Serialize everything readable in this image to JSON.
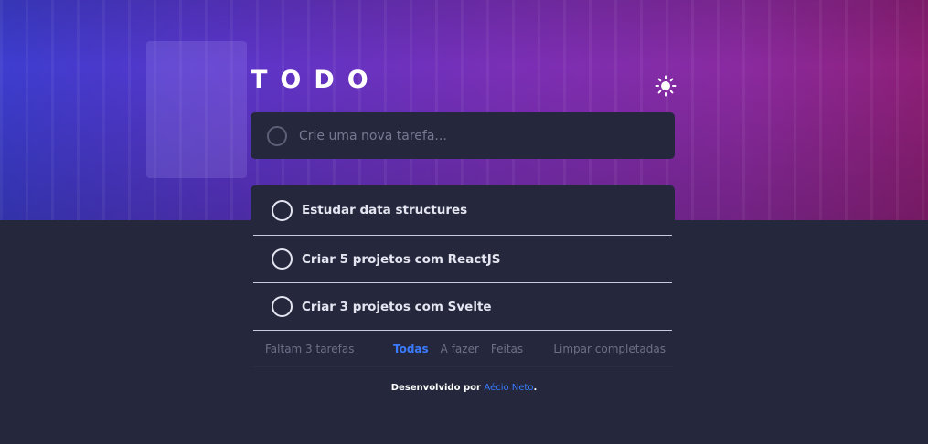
{
  "header": {
    "title": "TODO",
    "theme_icon": "sun-icon"
  },
  "new_todo": {
    "placeholder": "Crie uma nova tarefa..."
  },
  "todos": [
    {
      "text": "Estudar data structures",
      "completed": false
    },
    {
      "text": "Criar 5 projetos com ReactJS",
      "completed": false
    },
    {
      "text": "Criar 3 projetos com Svelte",
      "completed": false
    }
  ],
  "footer": {
    "remaining": "Faltam 3 tarefas",
    "filters": {
      "all": "Todas",
      "active": "A fazer",
      "done": "Feitas"
    },
    "active_filter": "all",
    "clear": "Limpar completadas"
  },
  "credit": {
    "prefix": "Desenvolvido por",
    "author": "Aécio Neto",
    "suffix": "."
  },
  "colors": {
    "accent": "#3a7bfd",
    "background": "#25273c",
    "gradient_start": "#3d3dcf",
    "gradient_end": "#8e1f77"
  }
}
